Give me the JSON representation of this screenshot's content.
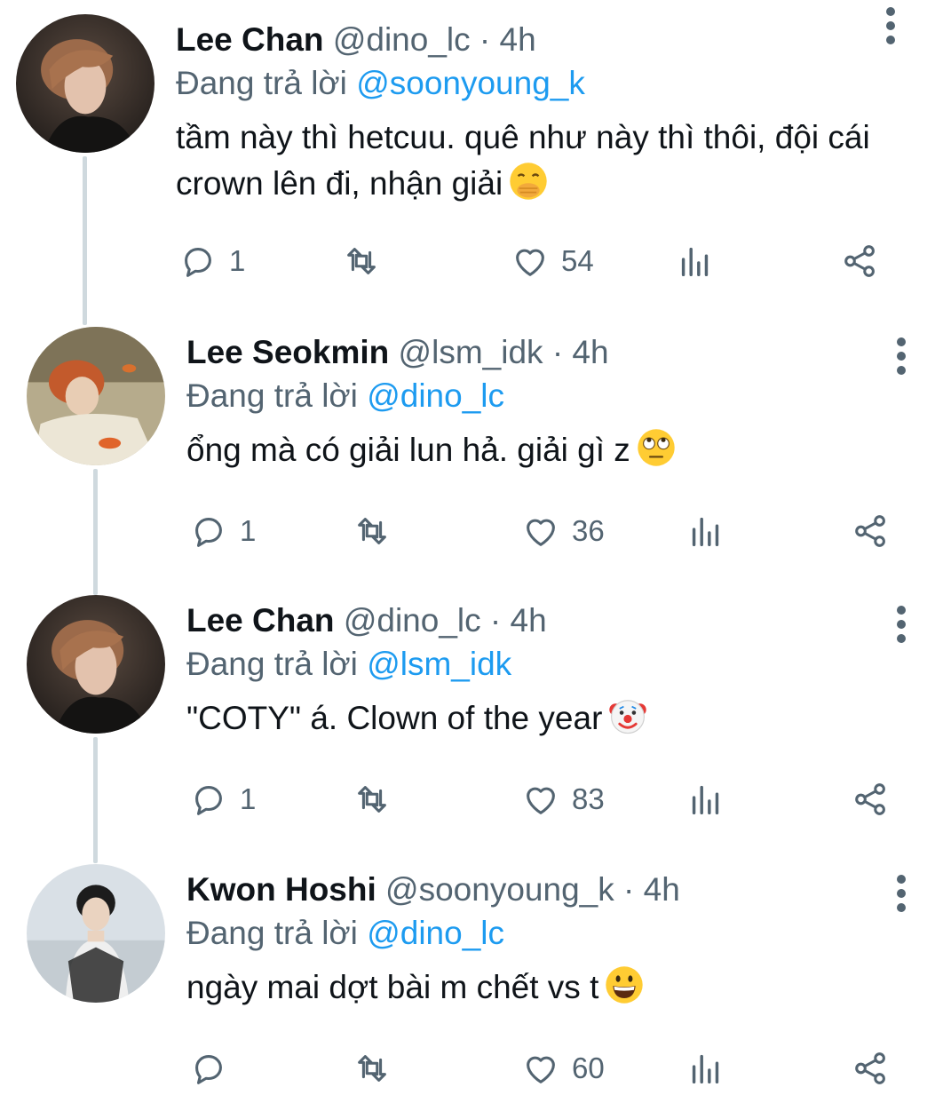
{
  "reply_prefix": "Đang trả lời",
  "colors": {
    "text": "#0f1419",
    "secondary": "#536471",
    "link": "#1d9bf0",
    "thread_line": "#cfd9de"
  },
  "tweets": [
    {
      "display_name": "Lee Chan",
      "handle": "@dino_lc",
      "separator": "·",
      "time": "4h",
      "replying_to": "@soonyoung_k",
      "text": "tầm này thì hetcuu. quê như này thì thôi, đội cái crown lên đi, nhận giải",
      "emoji": "hand-over-mouth-emoji",
      "avatar": "avatar-lee-chan",
      "replies": "1",
      "likes": "54"
    },
    {
      "display_name": "Lee Seokmin",
      "handle": "@lsm_idk",
      "separator": "·",
      "time": "4h",
      "replying_to": "@dino_lc",
      "text": "ổng mà có giải lun hả. giải gì z",
      "emoji": "eye-roll-emoji",
      "avatar": "avatar-lee-seokmin",
      "replies": "1",
      "likes": "36"
    },
    {
      "display_name": "Lee Chan",
      "handle": "@dino_lc",
      "separator": "·",
      "time": "4h",
      "replying_to": "@lsm_idk",
      "text": "\"COTY\" á. Clown of the year",
      "emoji": "clown-face-emoji",
      "avatar": "avatar-lee-chan",
      "replies": "1",
      "likes": "83"
    },
    {
      "display_name": "Kwon Hoshi",
      "handle": "@soonyoung_k",
      "separator": "·",
      "time": "4h",
      "replying_to": "@dino_lc",
      "text": "ngày mai dợt bài m chết vs t",
      "emoji": "grinning-face-emoji",
      "avatar": "avatar-kwon-hoshi",
      "replies": "",
      "likes": "60"
    }
  ]
}
